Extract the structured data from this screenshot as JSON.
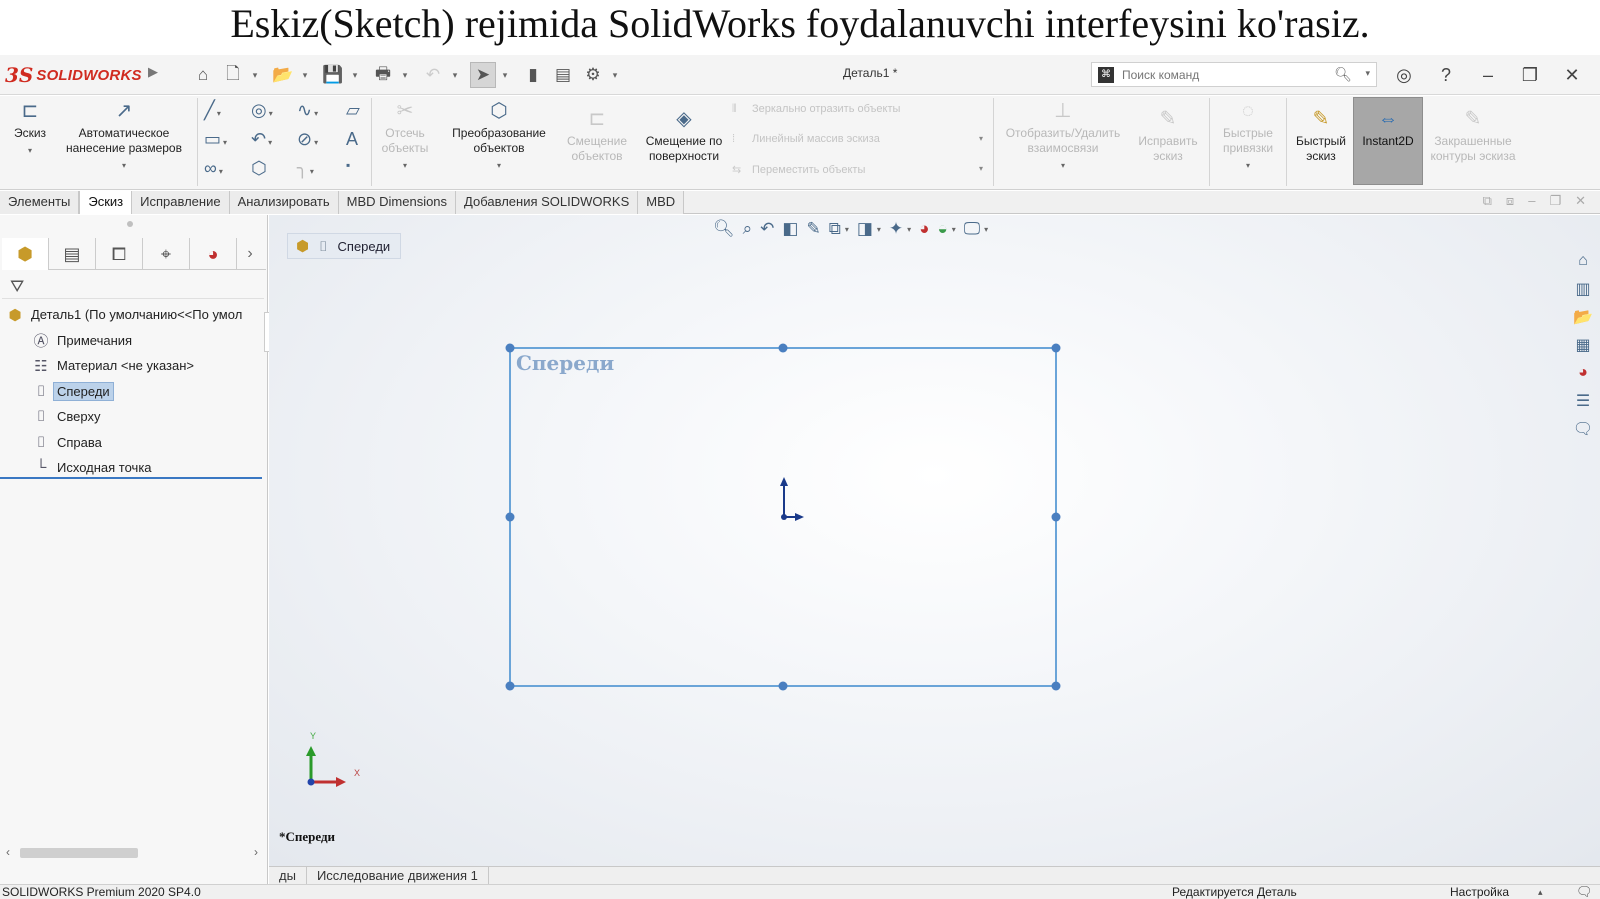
{
  "slide": {
    "title": "Eskiz(Sketch) rejimida SolidWorks foydalanuvchi interfeysini ko'rasiz."
  },
  "titlebar": {
    "logo_mark": "3S",
    "logo_text": "SOLIDWORKS",
    "document_title": "Деталь1 *",
    "search_placeholder": "Поиск команд",
    "icons": [
      "home-icon",
      "new-document-icon",
      "open-icon",
      "save-icon",
      "print-icon",
      "undo-icon",
      "select-cursor-icon",
      "rebuild-icon",
      "file-properties-icon",
      "options-gear-icon"
    ]
  },
  "ribbon": {
    "sketch": "Эскиз",
    "smart_dimension": "Автоматическое нанесение размеров",
    "trim_entities": "Отсечь объекты",
    "convert_entities": "Преобразование объектов",
    "offset_entities": "Смещение объектов",
    "offset_on_surface": "Смещение по поверхности",
    "mirror_entities": "Зеркально отразить объекты",
    "linear_pattern": "Линейный массив эскиза",
    "move_entities": "Переместить объекты",
    "display_delete_relations": "Отобразить/Удалить взаимосвязи",
    "repair_sketch": "Исправить эскиз",
    "quick_snaps": "Быстрые привязки",
    "rapid_sketch": "Быстрый эскиз",
    "instant2d": "Instant2D",
    "shaded_contours": "Закрашенные контуры эскиза"
  },
  "tabs": [
    {
      "label": "Элементы",
      "active": false
    },
    {
      "label": "Эскиз",
      "active": true
    },
    {
      "label": "Исправление",
      "active": false
    },
    {
      "label": "Анализировать",
      "active": false
    },
    {
      "label": "MBD Dimensions",
      "active": false
    },
    {
      "label": "Добавления SOLIDWORKS",
      "active": false
    },
    {
      "label": "MBD",
      "active": false
    }
  ],
  "tree": {
    "root": "Деталь1  (По умолчанию<<По умол",
    "items": [
      {
        "label": "Примечания",
        "icon": "annotations-icon"
      },
      {
        "label": "Материал <не указан>",
        "icon": "material-icon"
      },
      {
        "label": "Спереди",
        "icon": "plane-icon",
        "selected": true
      },
      {
        "label": "Сверху",
        "icon": "plane-icon"
      },
      {
        "label": "Справа",
        "icon": "plane-icon"
      },
      {
        "label": "Исходная точка",
        "icon": "origin-icon"
      }
    ]
  },
  "viewport": {
    "breadcrumb": "Спереди",
    "plane_label": "Спереди",
    "status_label": "*Спереди",
    "triad_x": "X",
    "triad_y": "Y"
  },
  "bottom_tabs": [
    "ды",
    "Исследование движения 1"
  ],
  "statusbar": {
    "left": "SOLIDWORKS Premium 2020 SP4.0",
    "middle": "Редактируется Деталь",
    "right": "Настройка"
  },
  "colors": {
    "brand_red": "#d02b20",
    "sketch_blue": "#5b9bd5",
    "selection_blue": "#bcd2ea"
  }
}
